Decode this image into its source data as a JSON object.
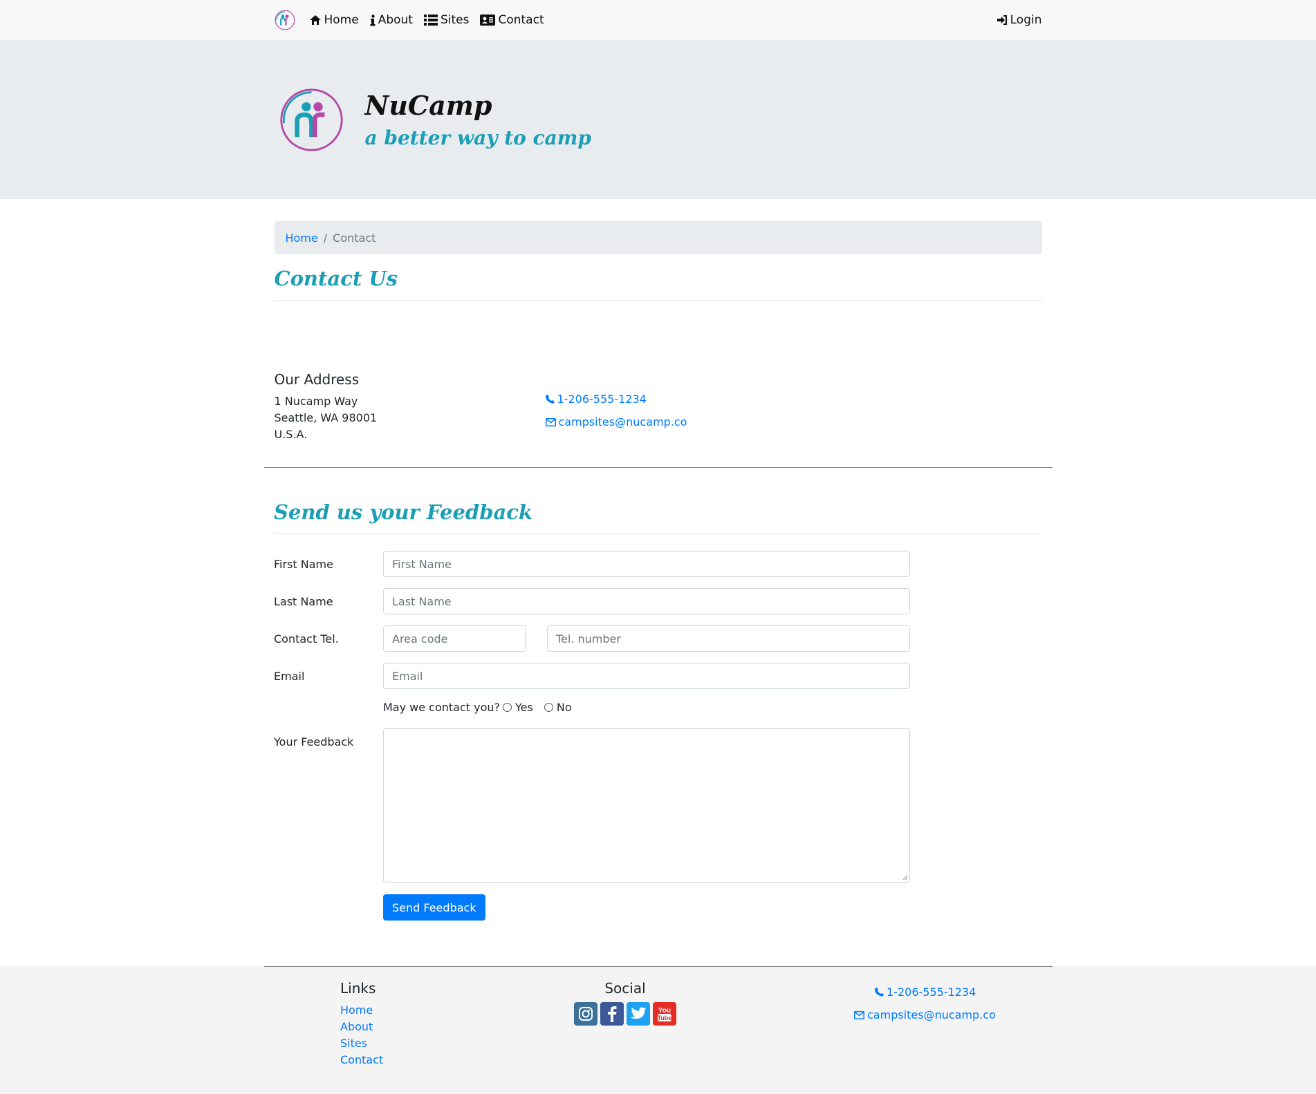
{
  "nav": {
    "items": [
      {
        "label": "Home",
        "icon": "home-icon"
      },
      {
        "label": "About",
        "icon": "info-icon"
      },
      {
        "label": "Sites",
        "icon": "list-icon"
      },
      {
        "label": "Contact",
        "icon": "address-card-icon"
      }
    ],
    "login": "Login"
  },
  "brand": {
    "title": "NuCamp",
    "subtitle": "a better way to camp"
  },
  "breadcrumb": {
    "home": "Home",
    "separator": "/",
    "current": "Contact"
  },
  "contact": {
    "title": "Contact Us",
    "address_heading": "Our Address",
    "address_lines": [
      "1 Nucamp Way",
      "Seattle, WA 98001",
      "U.S.A."
    ],
    "phone": "1-206-555-1234",
    "email": "campsites@nucamp.co"
  },
  "feedback": {
    "title": "Send us your Feedback",
    "first_name_label": "First Name",
    "first_name_placeholder": "First Name",
    "last_name_label": "Last Name",
    "last_name_placeholder": "Last Name",
    "tel_label": "Contact Tel.",
    "area_code_placeholder": "Area code",
    "tel_number_placeholder": "Tel. number",
    "email_label": "Email",
    "email_placeholder": "Email",
    "may_contact": "May we contact you?",
    "yes": "Yes",
    "no": "No",
    "feedback_label": "Your Feedback",
    "submit": "Send Feedback"
  },
  "footer": {
    "links_heading": "Links",
    "links": [
      "Home",
      "About",
      "Sites",
      "Contact"
    ],
    "social_heading": "Social",
    "social": [
      {
        "name": "instagram-icon",
        "color": "#3f729b"
      },
      {
        "name": "facebook-icon",
        "color": "#3b5998"
      },
      {
        "name": "twitter-icon",
        "color": "#1da1f2"
      },
      {
        "name": "youtube-icon",
        "color": "#e52d27"
      }
    ],
    "phone": "1-206-555-1234",
    "email": "campsites@nucamp.co"
  },
  "colors": {
    "accent": "#1b9fb6",
    "link": "#007bff",
    "navbar_bg": "#f8f8f8",
    "jumbotron_bg": "#e9ecef"
  }
}
